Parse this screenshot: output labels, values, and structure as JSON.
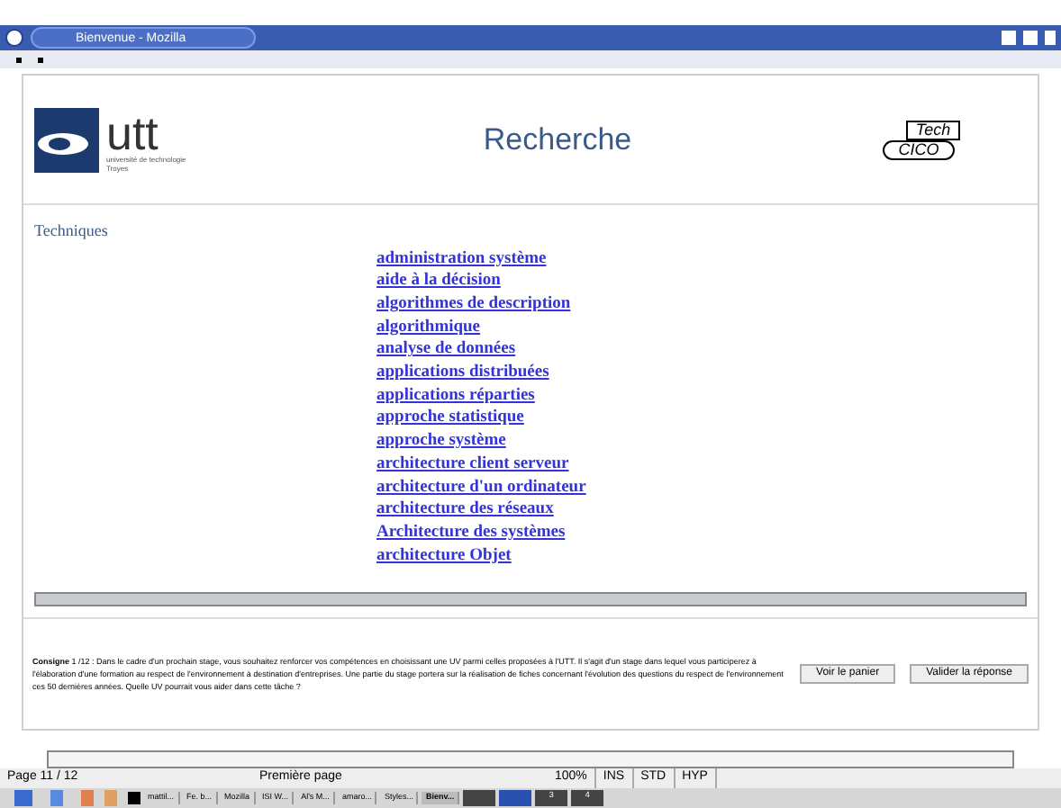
{
  "window": {
    "title": "Bienvenue - Mozilla"
  },
  "header": {
    "logo_text": "utt",
    "logo_caption": "université de technologie Troyes",
    "title": "Recherche",
    "partner_logo": [
      "Tech",
      "CICO"
    ]
  },
  "section": {
    "title": "Techniques",
    "links": [
      "administration système",
      "aide à la décision",
      "algorithmes de description",
      "algorithmique",
      "analyse de données",
      "applications distribuées",
      "applications réparties",
      "approche statistique",
      "approche système",
      "architecture client serveur",
      "architecture d'un ordinateur",
      "architecture des réseaux",
      "Architecture des systèmes",
      "architecture Objet"
    ]
  },
  "instruction": {
    "text": "**Consigne** 1 /12 : Dans le cadre d'un prochain stage, vous souhaitez renforcer vos compétences en choisissant une UV parmi celles proposées à l'UTT. Il s'agit d'un stage dans lequel vous participerez à l'élaboration d'une formation au respect de l'environnement à destination d'entreprises. Une partie du stage portera sur la réalisation de fiches concernant l'évolution des questions du respect de l'environnement ces 50 dernières années. Quelle UV pourrait vous aider dans cette tâche ?",
    "buttons": [
      "Voir le panier",
      "Valider la réponse"
    ]
  },
  "status_bar": {
    "page": "Page 11 / 12",
    "style": "Première page",
    "zoom": "100%",
    "flags": [
      "INS",
      "STD",
      "HYP"
    ]
  },
  "taskbar": {
    "tasks": [
      {
        "label": "mattil...",
        "selected": false
      },
      {
        "label": "Fe. b...",
        "selected": false
      },
      {
        "label": "Mozilla",
        "selected": false
      },
      {
        "label": "ISI W...",
        "selected": false
      },
      {
        "label": "Al's M...",
        "selected": false
      },
      {
        "label": "amaro...",
        "selected": false
      },
      {
        "label": "Styles...",
        "selected": false
      },
      {
        "label": "Bienv...",
        "selected": true
      }
    ],
    "desktops": [
      {
        "selected": false
      },
      {
        "selected": true
      },
      {
        "label": "3",
        "selected": false
      },
      {
        "label": "4",
        "selected": false
      }
    ]
  }
}
